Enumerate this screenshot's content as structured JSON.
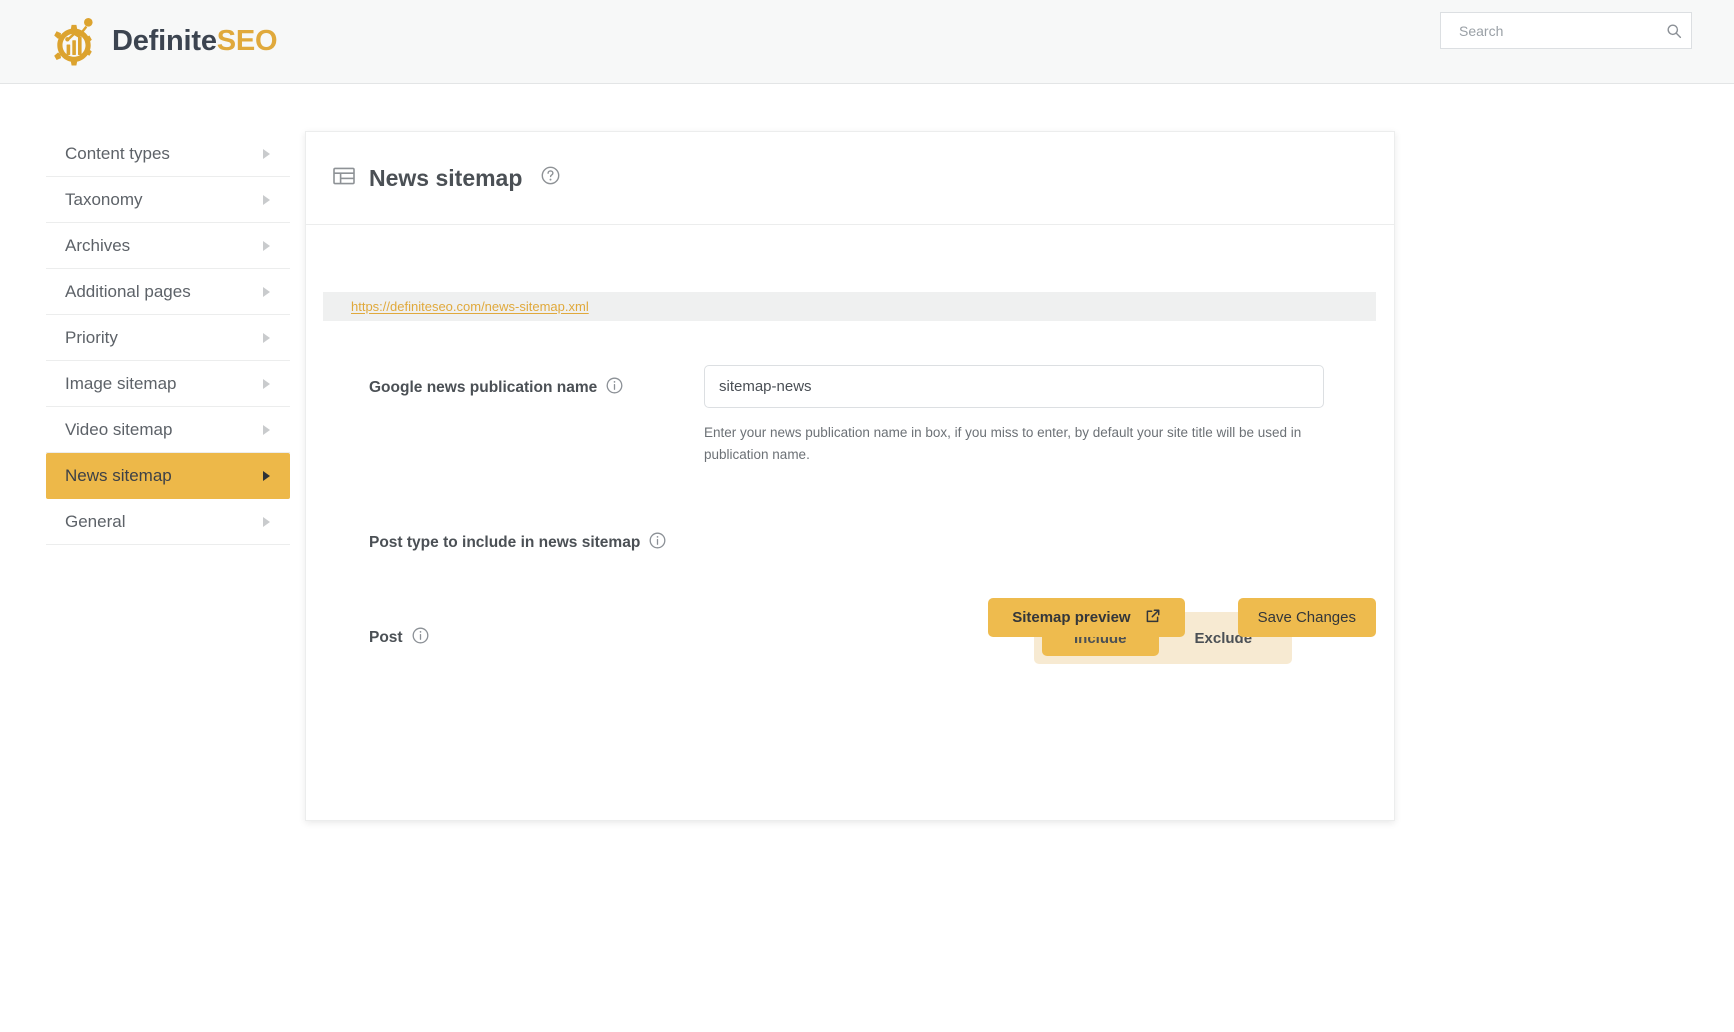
{
  "header": {
    "brand_first": "Definite",
    "brand_second": "SEO",
    "logo_icon": "gear-chart-logo",
    "search": {
      "placeholder": "Search",
      "value": "",
      "icon": "search-icon"
    }
  },
  "sidebar": {
    "items": [
      {
        "label": "Content types",
        "active": false,
        "icon": "chevron-right-icon"
      },
      {
        "label": "Taxonomy",
        "active": false,
        "icon": "chevron-right-icon"
      },
      {
        "label": "Archives",
        "active": false,
        "icon": "chevron-right-icon"
      },
      {
        "label": "Additional pages",
        "active": false,
        "icon": "chevron-right-icon"
      },
      {
        "label": "Priority",
        "active": false,
        "icon": "chevron-right-icon"
      },
      {
        "label": "Image sitemap",
        "active": false,
        "icon": "chevron-right-icon"
      },
      {
        "label": "Video sitemap",
        "active": false,
        "icon": "chevron-right-icon"
      },
      {
        "label": "News sitemap",
        "active": true,
        "icon": "chevron-right-icon"
      },
      {
        "label": "General",
        "active": false,
        "icon": "chevron-right-icon"
      }
    ]
  },
  "card": {
    "title": "News sitemap",
    "title_icon": "table-icon",
    "help_icon": "question-circle-icon",
    "sitemap_url": "https://definiteseo.com/news-sitemap.xml",
    "publication": {
      "label": "Google news publication name",
      "info_icon": "info-circle-icon",
      "value": "sitemap-news",
      "placeholder": "sitemap-news",
      "help_text": "Enter your news publication name in box, if you miss to enter, by default your site title will be used in publication name."
    },
    "post_type_section": {
      "label": "Post type to include in news sitemap",
      "info_icon": "info-circle-icon"
    },
    "post_row": {
      "label": "Post",
      "info_icon": "info-circle-icon",
      "options": [
        "Include",
        "Exclude"
      ],
      "include_label": "Include",
      "exclude_label": "Exclude",
      "selected": "Include"
    },
    "actions": {
      "preview_label": "Sitemap preview",
      "preview_icon": "external-link-icon",
      "save_label": "Save Changes"
    }
  },
  "colors": {
    "accent": "#edb849",
    "accent_button": "#eebb4e",
    "accent_link": "#e0a93c",
    "toggle_track": "#f7ead2",
    "text_dark": "#4b5055",
    "topbar_bg": "#f7f8f8"
  }
}
